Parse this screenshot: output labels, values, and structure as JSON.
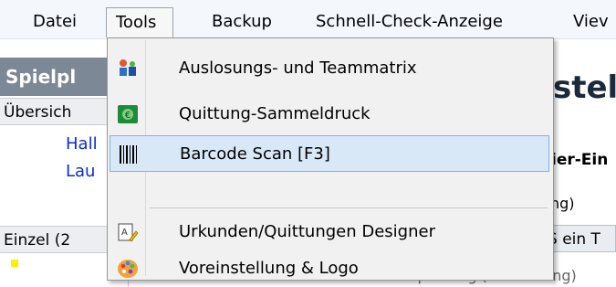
{
  "menubar": {
    "items": [
      {
        "label": "Datei"
      },
      {
        "label": "Tools"
      },
      {
        "label": "Backup"
      },
      {
        "label": "Schnell-Check-Anzeige"
      },
      {
        "label": "Viev"
      }
    ]
  },
  "left": {
    "title": "Spielpl",
    "tab_overview": "Übersich",
    "links": [
      "Hall",
      "Lau"
    ],
    "tab_single": "Einzel (2"
  },
  "right": {
    "title": "stell",
    "subtitle": "ier-Ein",
    "text1": "ng)",
    "button": "S ein T",
    "text2": "Zeitplanung (Aktivierung)"
  },
  "dropdown": {
    "items": [
      {
        "label": "Auslosungs- und Teammatrix",
        "icon": "team-matrix-icon"
      },
      {
        "label": "Quittung-Sammeldruck",
        "icon": "receipt-print-icon"
      },
      {
        "label": "Barcode Scan [F3]",
        "icon": "barcode-icon"
      },
      {
        "label": "Urkunden/Quittungen Designer",
        "icon": "designer-icon"
      },
      {
        "label": "Voreinstellung & Logo",
        "icon": "palette-icon"
      }
    ]
  }
}
